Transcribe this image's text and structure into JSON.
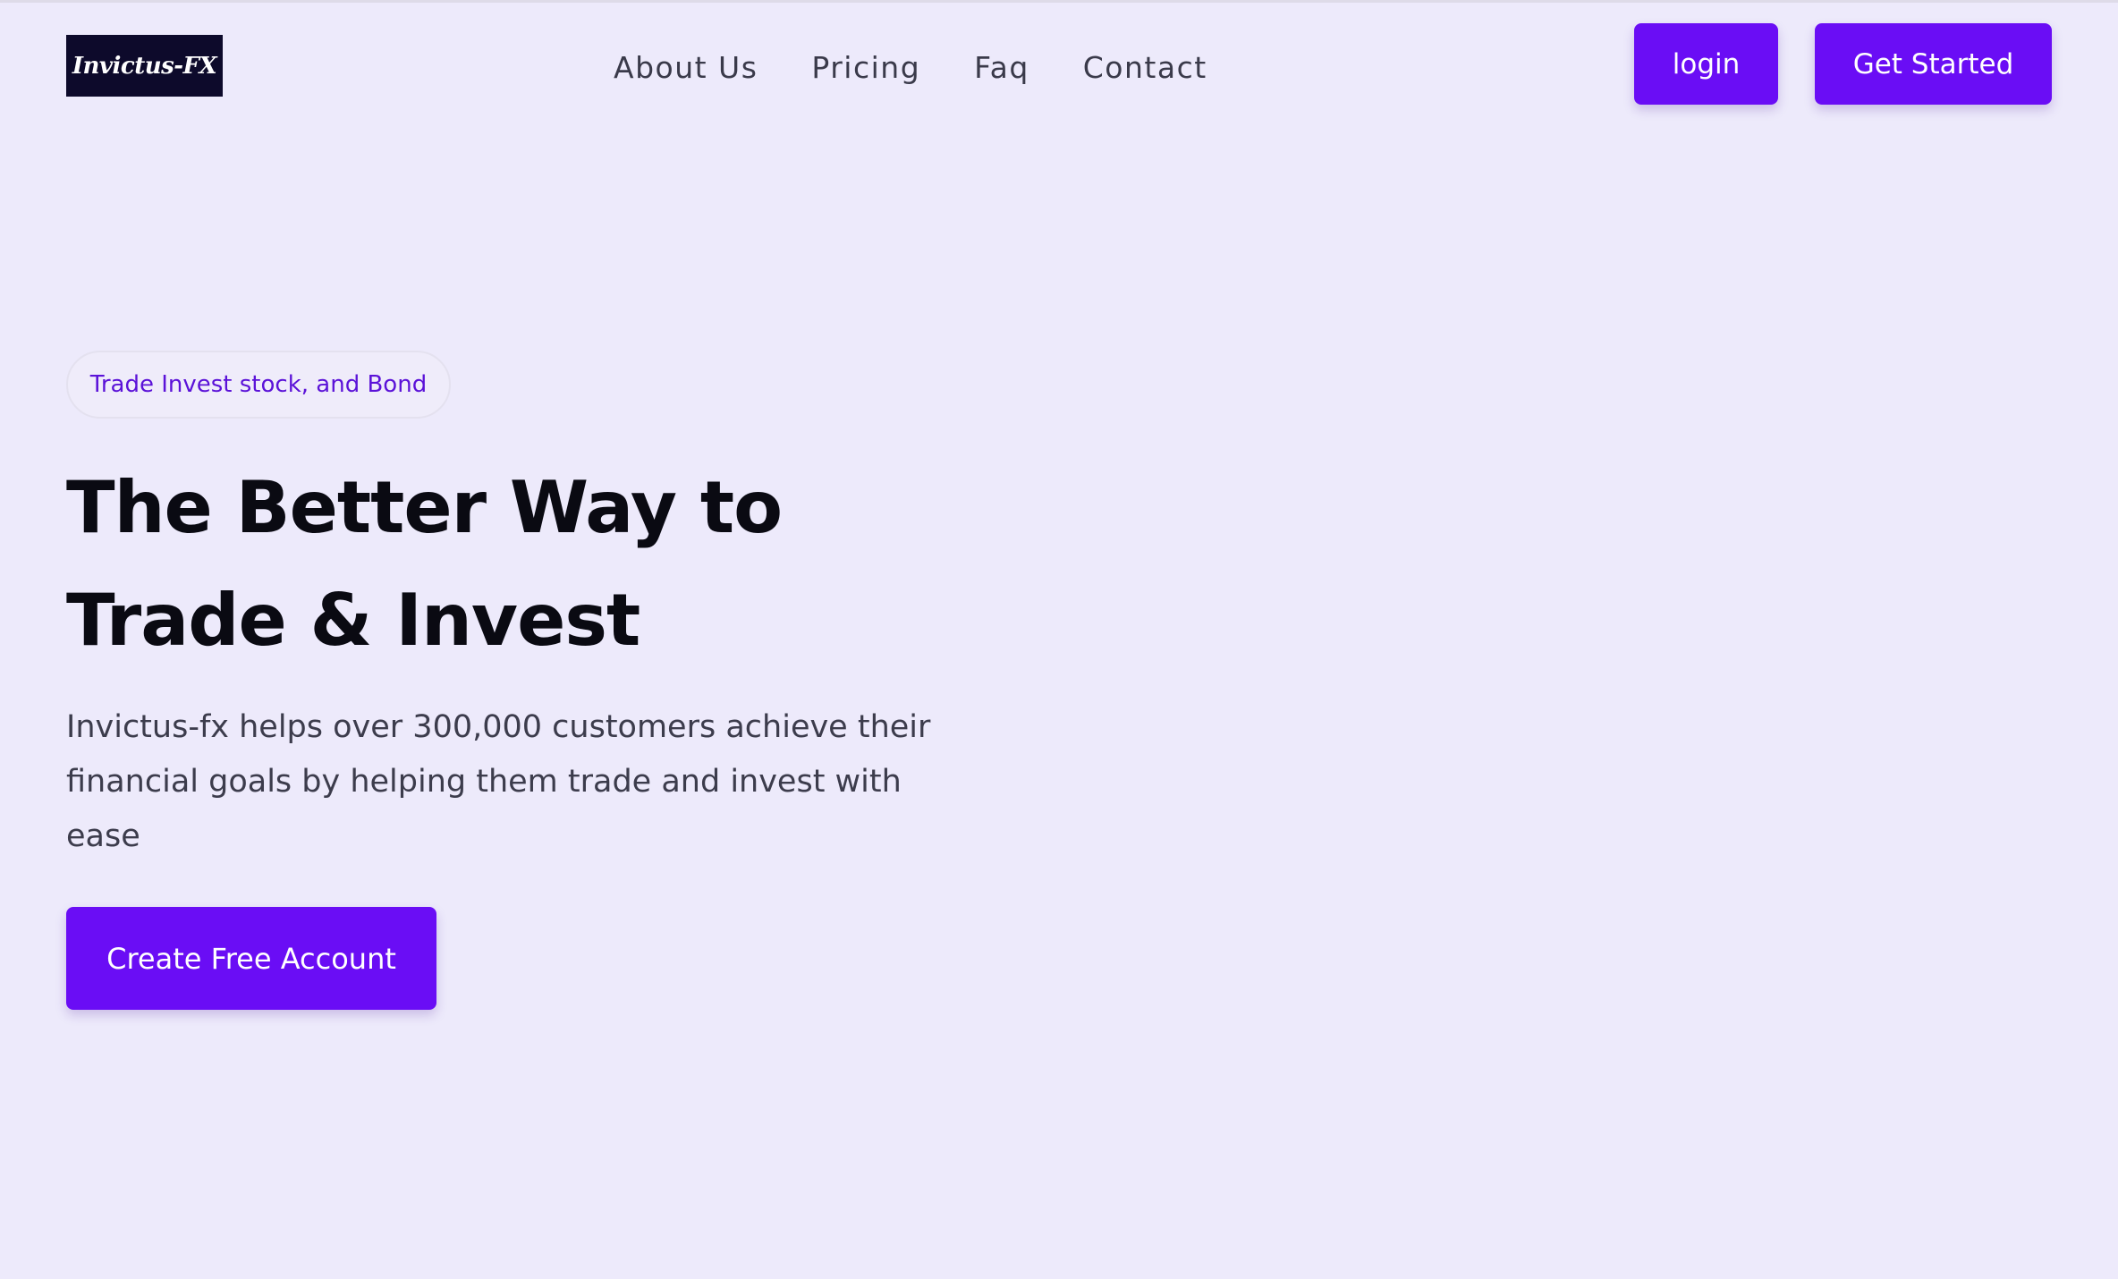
{
  "brand": {
    "logo_text": "Invictus-FX"
  },
  "nav": {
    "items": [
      "About Us",
      "Pricing",
      "Faq",
      "Contact"
    ]
  },
  "header": {
    "login_label": "login",
    "get_started_label": "Get Started"
  },
  "hero": {
    "pill_text": "Trade Invest stock, and Bond",
    "headline_line1": "The Better Way to",
    "headline_line2": "Trade & Invest",
    "description": "Invictus-fx helps over 300,000 customers achieve their financial goals by helping them trade and invest with ease",
    "cta_label": "Create Free Account"
  },
  "colors": {
    "background": "#edeafb",
    "accent": "#6a0df5",
    "logo_bg": "#0d0a2b",
    "pill_text": "#5b12d8"
  }
}
